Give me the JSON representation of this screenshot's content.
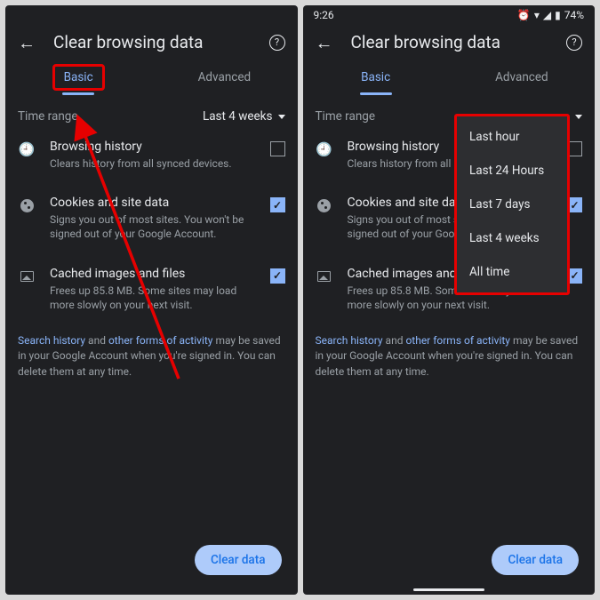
{
  "statusbar": {
    "time": "9:26",
    "battery": "74%"
  },
  "header": {
    "title": "Clear browsing data"
  },
  "tabs": {
    "basic": "Basic",
    "advanced": "Advanced"
  },
  "timerange": {
    "label": "Time range",
    "value": "Last 4 weeks"
  },
  "items": {
    "history": {
      "title": "Browsing history",
      "desc": "Clears history from all synced devices."
    },
    "cookies": {
      "title": "Cookies and site data",
      "desc": "Signs you out of most sites. You won't be signed out of your Google Account."
    },
    "cache": {
      "title": "Cached images and files",
      "desc": "Frees up 85.8 MB. Some sites may load more slowly on your next visit."
    }
  },
  "note": {
    "link1": "Search history",
    "mid": " and ",
    "link2": "other forms of activity",
    "rest": " may be saved in your Google Account when you're signed in. You can delete them at any time."
  },
  "button": "Clear data",
  "dropdown": [
    "Last hour",
    "Last 24 Hours",
    "Last 7 days",
    "Last 4 weeks",
    "All time"
  ]
}
